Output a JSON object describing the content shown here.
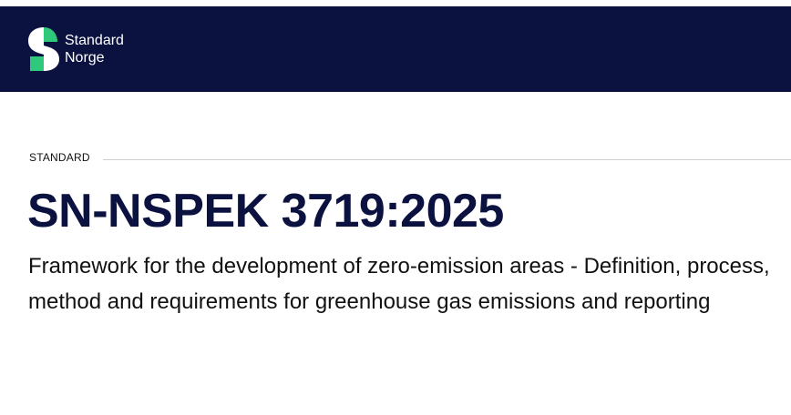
{
  "brand": {
    "name_line1": "Standard",
    "name_line2": "Norge",
    "colors": {
      "navy": "#0b1240",
      "green": "#2ec97a",
      "white": "#ffffff"
    },
    "logo_icon": "standard-norge-s-logo"
  },
  "document": {
    "category": "STANDARD",
    "code": "SN-NSPEK 3719:2025",
    "title": "Framework for the development of zero-emission areas - Definition, process, method and requirements for greenhouse gas emissions and reporting"
  }
}
